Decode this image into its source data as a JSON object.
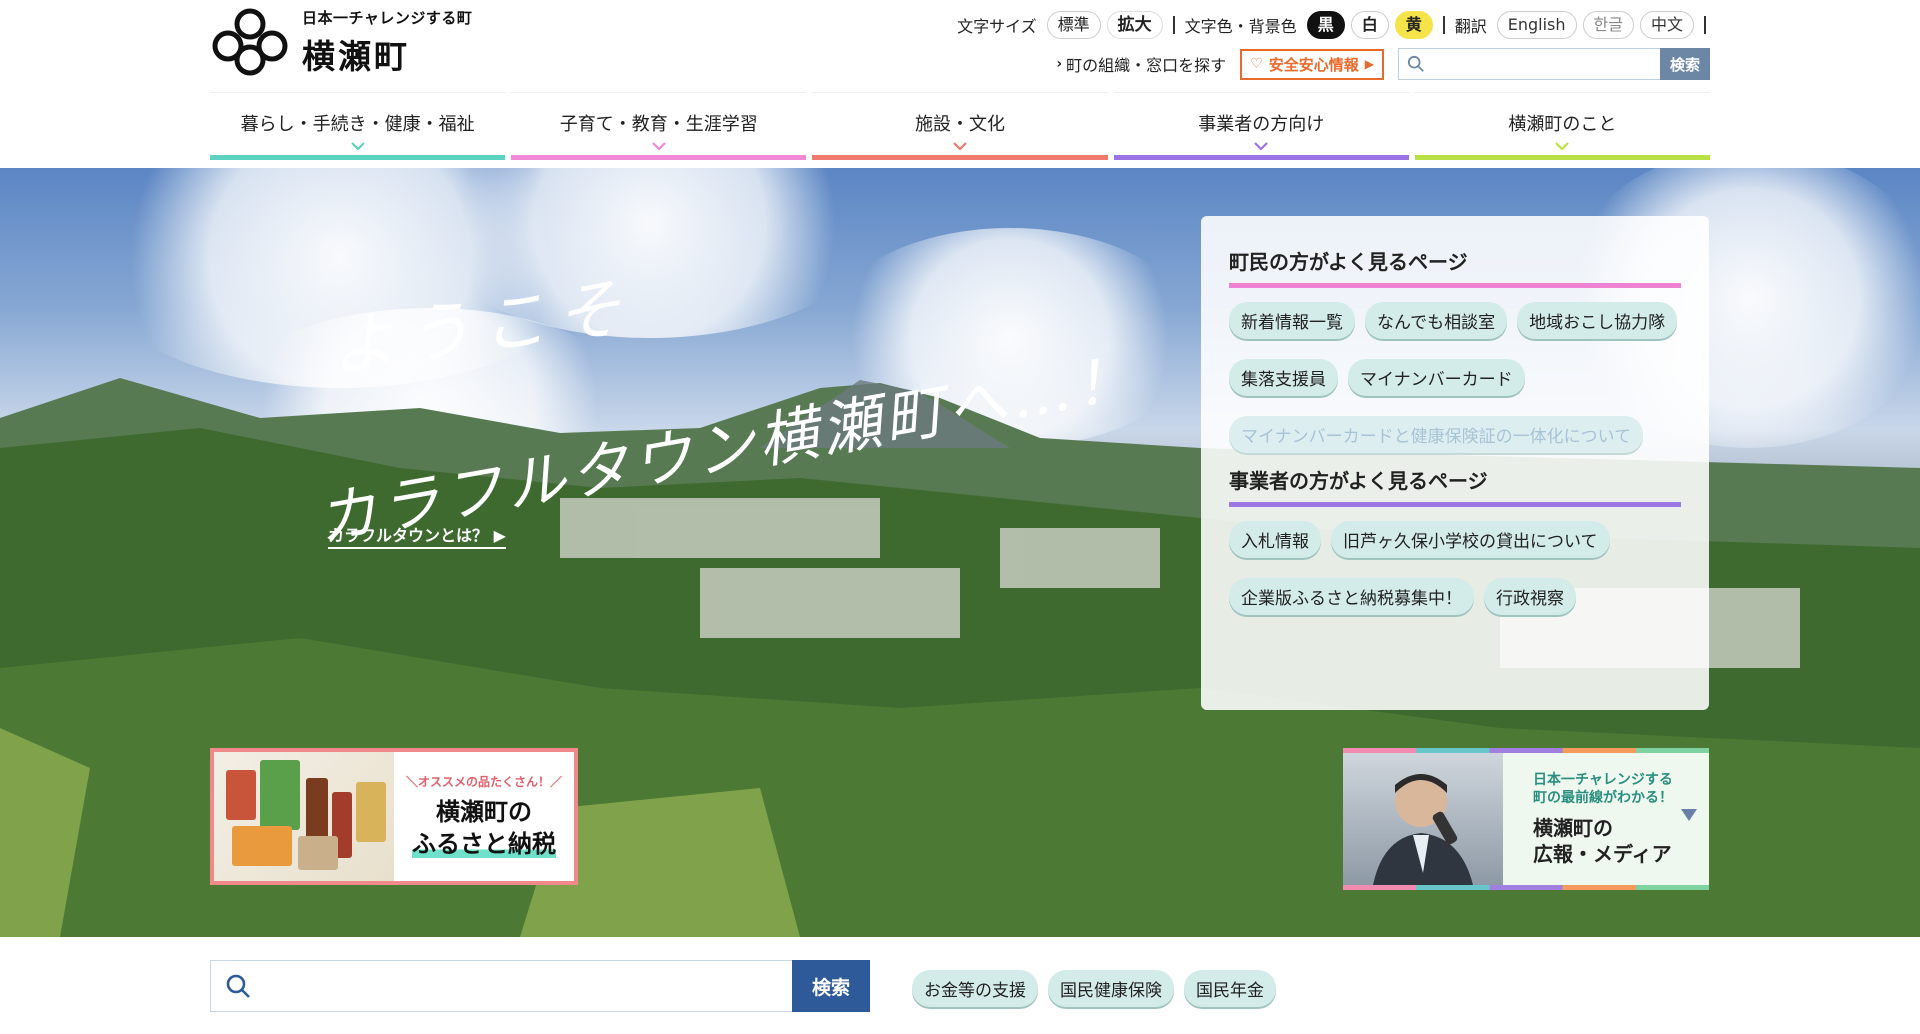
{
  "site": {
    "tagline": "日本一チャレンジする町",
    "name": "横瀬町"
  },
  "utility": {
    "font_size_label": "文字サイズ",
    "font_standard": "標準",
    "font_large": "拡大",
    "color_label": "文字色・背景色",
    "color_black": "黒",
    "color_white": "白",
    "color_yellow": "黄",
    "translate_label": "翻訳",
    "lang_en": "English",
    "lang_ko": "한글",
    "lang_zh": "中文",
    "org_link": "町の組織・窓口を探す",
    "safety_label": "安全安心情報",
    "search_button": "検索",
    "search_placeholder": ""
  },
  "gnav": [
    {
      "label": "暮らし・手続き・健康・福祉",
      "color": "#5cd3c0"
    },
    {
      "label": "子育て・教育・生涯学習",
      "color": "#f08ad6"
    },
    {
      "label": "施設・文化",
      "color": "#f07a6e"
    },
    {
      "label": "事業者の方向け",
      "color": "#9a74e4"
    },
    {
      "label": "横瀬町のこと",
      "color": "#b9e045"
    }
  ],
  "hero": {
    "headline_1": "ようこそ",
    "headline_2": "カラフルタウン横瀬町へ…！",
    "colorful_link": "カラフルタウンとは？"
  },
  "quick": {
    "residents_heading": "町民の方がよく見るページ",
    "residents": [
      "新着情報一覧",
      "なんでも相談室",
      "地域おこし協力隊",
      "集落支援員",
      "マイナンバーカード",
      "マイナンバーカードと健康保険証の一体化について"
    ],
    "business_heading": "事業者の方がよく見るページ",
    "business": [
      "入札情報",
      "旧芦ヶ久保小学校の貸出について",
      "企業版ふるさと納税募集中！",
      "行政視察"
    ]
  },
  "banner_furusato": {
    "small": "＼オススメの品たくさん！／",
    "line1": "横瀬町の",
    "line2": "ふるさと納税"
  },
  "banner_media": {
    "small1": "日本一チャレンジする",
    "small2": "町の最前線がわかる！",
    "big1": "横瀬町の",
    "big2": "広報・メディア"
  },
  "main_search": {
    "button": "検索",
    "placeholder": "",
    "tags": [
      "お金等の支援",
      "国民健康保険",
      "国民年金"
    ]
  }
}
